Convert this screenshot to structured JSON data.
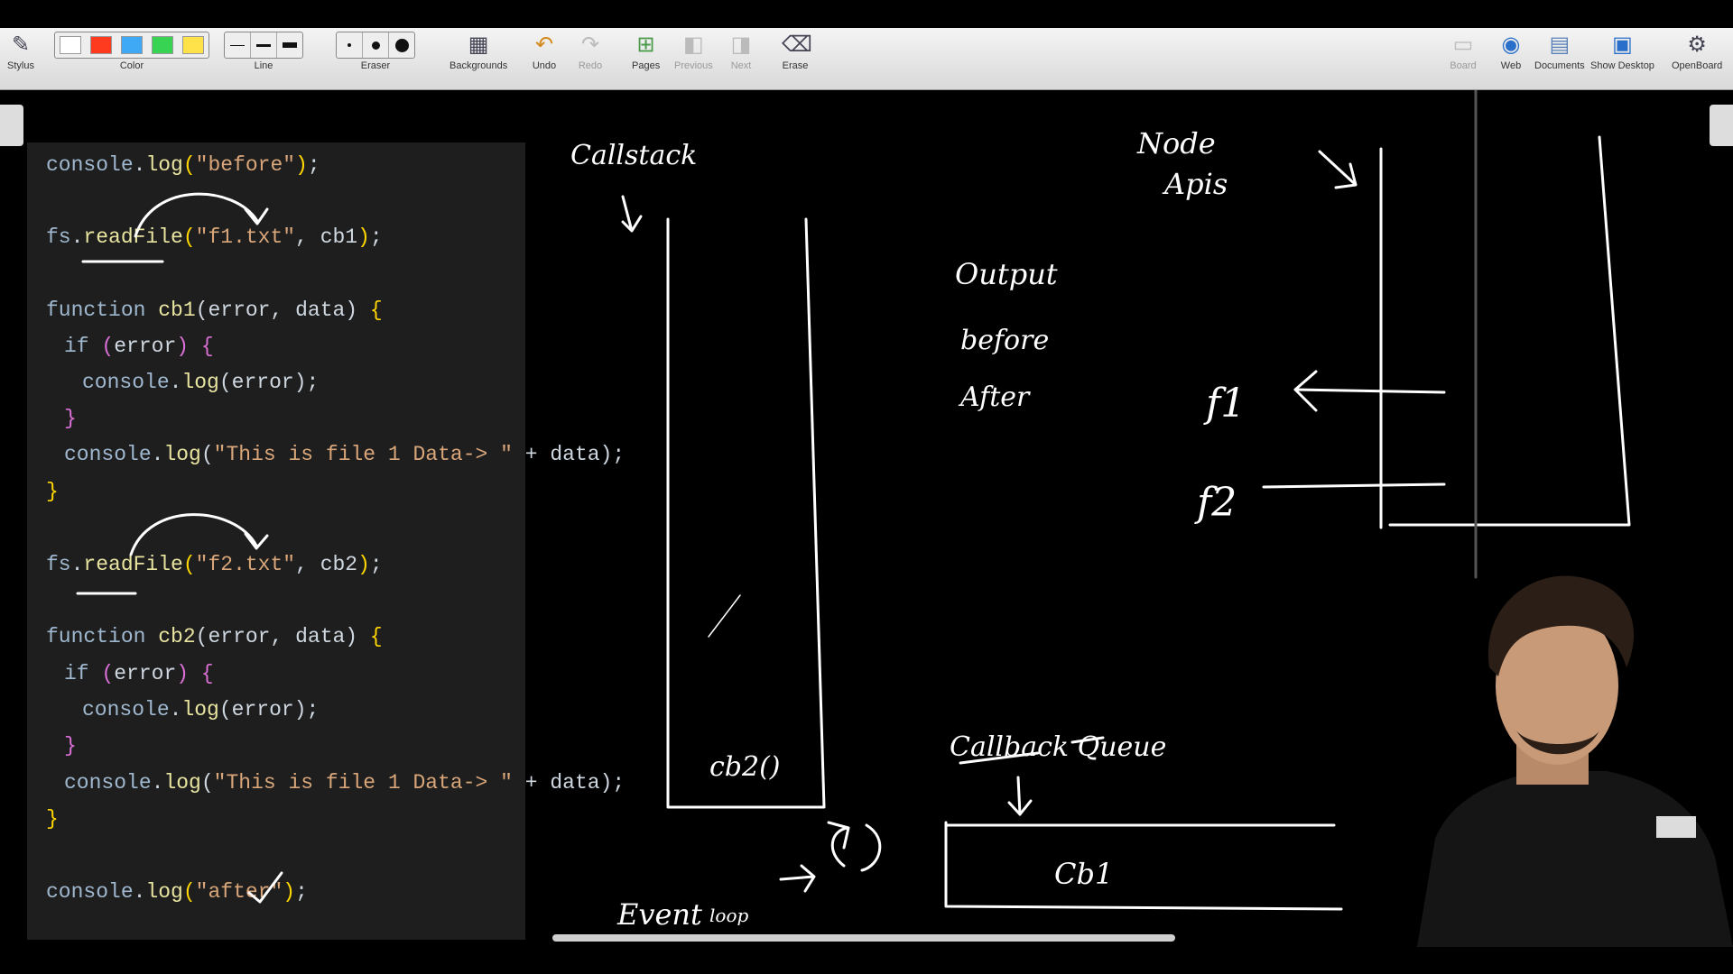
{
  "toolbar": {
    "stylus": "Stylus",
    "color": "Color",
    "line": "Line",
    "eraser": "Eraser",
    "backgrounds": "Backgrounds",
    "undo": "Undo",
    "redo": "Redo",
    "pages": "Pages",
    "previous": "Previous",
    "next": "Next",
    "erase": "Erase",
    "board": "Board",
    "web": "Web",
    "documents": "Documents",
    "show_desktop": "Show Desktop",
    "openboard": "OpenBoard",
    "colors": [
      "#ffffff",
      "#ff3b1f",
      "#3fa9f5",
      "#39d353",
      "#ffe14a"
    ]
  },
  "code": {
    "line1": {
      "obj": "console",
      "method": "log",
      "arg": "\"before\"",
      "end": ";"
    },
    "line2": {
      "obj": "fs",
      "method": "readFile",
      "arg": "\"f1.txt\"",
      "cb": "cb1",
      "end": ";"
    },
    "fn1": {
      "kw": "function",
      "name": "cb1",
      "params": "error, data",
      "open": "{"
    },
    "fn1_if": {
      "kw": "if",
      "cond": "error",
      "open": "{"
    },
    "fn1_log": {
      "obj": "console",
      "method": "log",
      "arg": "error",
      "end": ";"
    },
    "close_if": "}",
    "fn1_log2": {
      "obj": "console",
      "method": "log",
      "arg": "\"This is file 1 Data-> \"",
      "plus": " + ",
      "var": "data",
      "end": ";"
    },
    "close_fn": "}",
    "line3": {
      "obj": "fs",
      "method": "readFile",
      "arg": "\"f2.txt\"",
      "cb": "cb2",
      "end": ";"
    },
    "fn2": {
      "kw": "function",
      "name": "cb2",
      "params": "error, data",
      "open": "{"
    },
    "fn2_if": {
      "kw": "if",
      "cond": "error",
      "open": "{"
    },
    "fn2_log": {
      "obj": "console",
      "method": "log",
      "arg": "error",
      "end": ";"
    },
    "fn2_log2": {
      "obj": "console",
      "method": "log",
      "arg": "\"This is file 1 Data-> \"",
      "plus": " + ",
      "var": "data",
      "end": ";"
    },
    "line4": {
      "obj": "console",
      "method": "log",
      "arg": "\"after\"",
      "end": ";"
    }
  },
  "board": {
    "callstack": "Callstack",
    "node_apis_1": "Node",
    "node_apis_2": "Apis",
    "output": "Output",
    "out_before": "before",
    "out_after": "After",
    "f1": "f1",
    "f2": "f2",
    "stack_item": "cb2()",
    "callback_queue": "Callback Queue",
    "queue_item": "Cb1",
    "event_loop_1": "Event",
    "event_loop_2": "loop"
  }
}
